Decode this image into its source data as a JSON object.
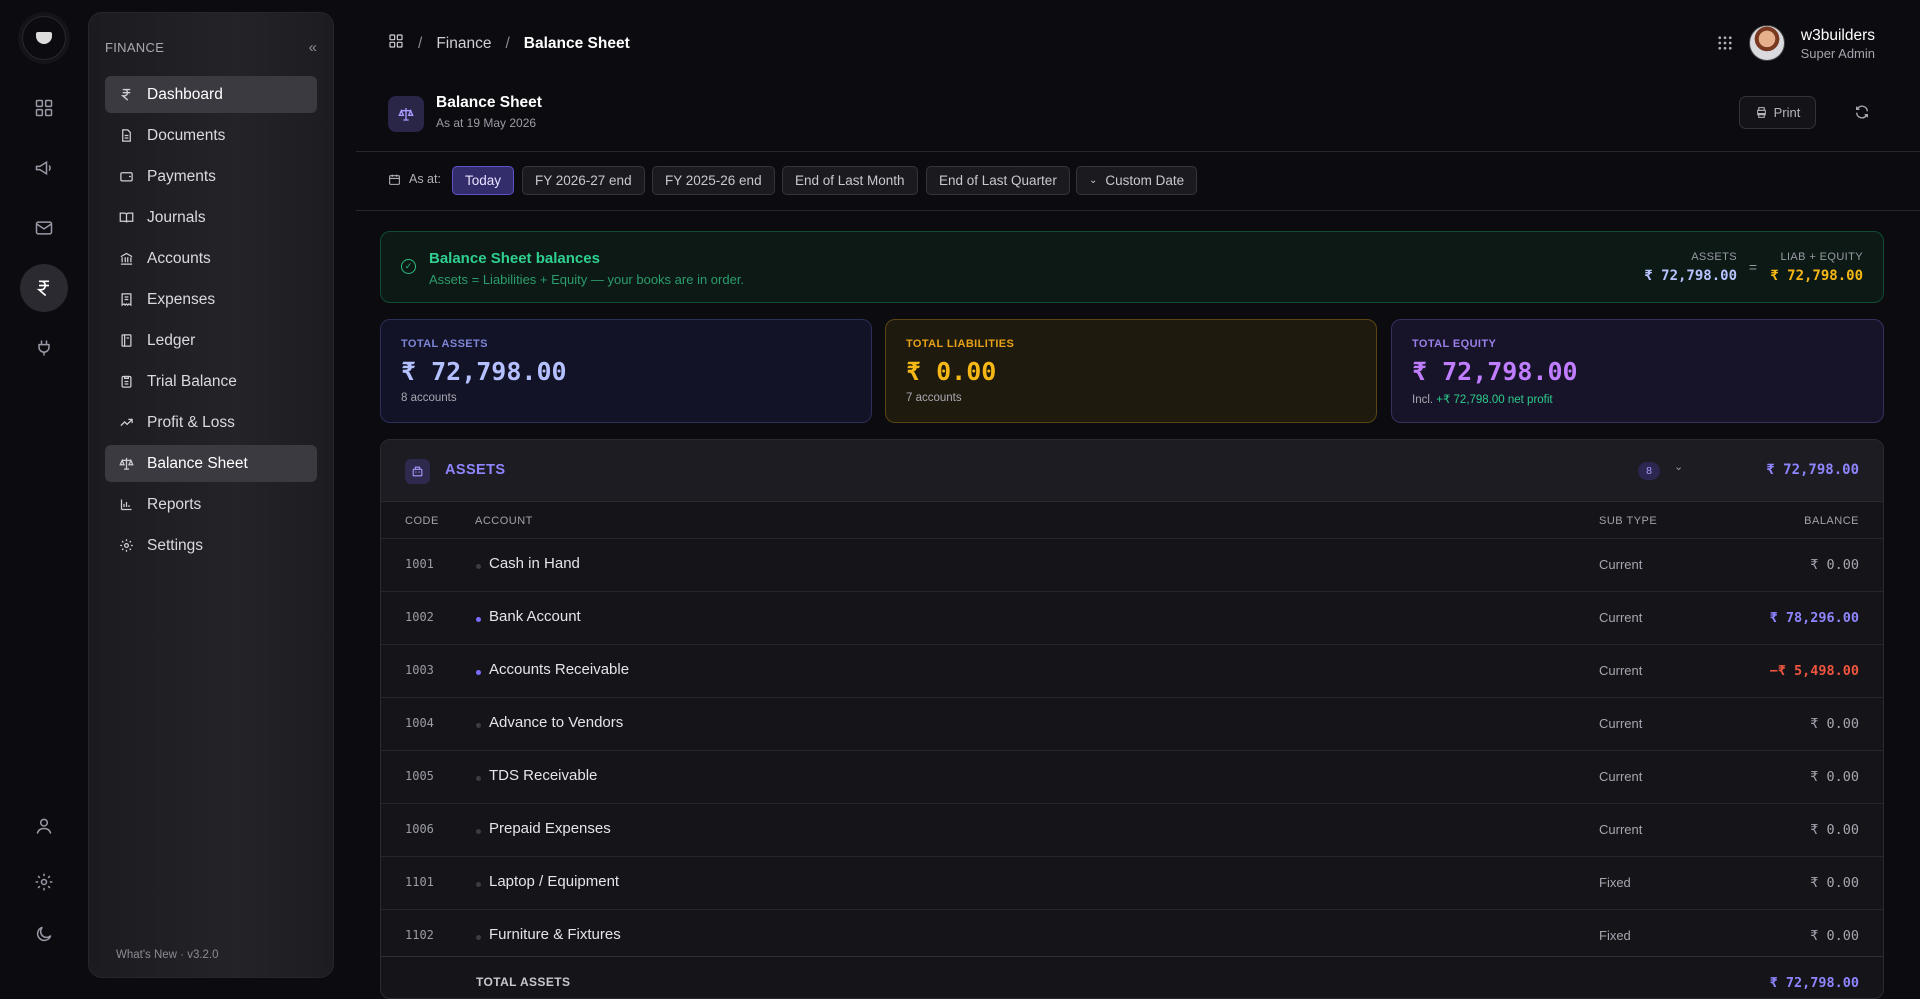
{
  "sidebar": {
    "heading": "FINANCE",
    "collapse_icon": "«",
    "items": [
      {
        "label": "Dashboard",
        "icon": "rupee-icon",
        "active": true
      },
      {
        "label": "Documents",
        "icon": "document-icon"
      },
      {
        "label": "Payments",
        "icon": "wallet-icon"
      },
      {
        "label": "Journals",
        "icon": "book-open-icon"
      },
      {
        "label": "Accounts",
        "icon": "bank-icon"
      },
      {
        "label": "Expenses",
        "icon": "receipt-icon"
      },
      {
        "label": "Ledger",
        "icon": "ledger-icon"
      },
      {
        "label": "Trial Balance",
        "icon": "clipboard-icon"
      },
      {
        "label": "Profit & Loss",
        "icon": "trend-up-icon"
      },
      {
        "label": "Balance Sheet",
        "icon": "scale-icon",
        "active": true
      },
      {
        "label": "Reports",
        "icon": "bar-chart-icon"
      },
      {
        "label": "Settings",
        "icon": "gear-icon"
      }
    ],
    "footer": "What's New · v3.2.0"
  },
  "breadcrumb": {
    "home_icon": "grid-icon",
    "items": [
      "Finance",
      "Balance Sheet"
    ]
  },
  "user": {
    "name": "w3builders",
    "role": "Super Admin"
  },
  "page": {
    "title": "Balance Sheet",
    "subtitle": "As at 19 May 2026",
    "print_label": "Print"
  },
  "filter": {
    "label": "As at:",
    "chips": [
      "Today",
      "FY 2026-27 end",
      "FY 2025-26 end",
      "End of Last Month",
      "End of Last Quarter"
    ],
    "custom_chev": "⌄",
    "custom_label": "Custom Date",
    "active": "Today"
  },
  "banner": {
    "check": "✓",
    "title": "Balance Sheet balances",
    "subtitle": "Assets = Liabilities + Equity — your books are in order.",
    "assets_label": "ASSETS",
    "assets_value": "₹ 72,798.00",
    "equals": "=",
    "liab_label": "LIAB + EQUITY",
    "liab_value": "₹ 72,798.00"
  },
  "cards": {
    "assets": {
      "label": "TOTAL ASSETS",
      "value": "₹ 72,798.00",
      "sub": "8 accounts"
    },
    "liabilities": {
      "label": "TOTAL LIABILITIES",
      "value": "₹ 0.00",
      "sub": "7 accounts"
    },
    "equity": {
      "label": "TOTAL EQUITY",
      "value": "₹ 72,798.00",
      "sub_prefix": "Incl.",
      "sub_highlight": "+₹ 72,798.00 net profit"
    }
  },
  "assets_panel": {
    "title": "ASSETS",
    "count": "8",
    "chev": "⌄",
    "total": "₹ 72,798.00",
    "columns": {
      "code": "CODE",
      "account": "ACCOUNT",
      "sub_type": "SUB TYPE",
      "balance": "BALANCE"
    },
    "rows": [
      {
        "code": "1001",
        "account": "Cash in Hand",
        "sub_type": "Current",
        "balance": "₹ 0.00",
        "state": "zero"
      },
      {
        "code": "1002",
        "account": "Bank Account",
        "sub_type": "Current",
        "balance": "₹ 78,296.00",
        "state": "pos"
      },
      {
        "code": "1003",
        "account": "Accounts Receivable",
        "sub_type": "Current",
        "balance": "−₹ 5,498.00",
        "state": "neg"
      },
      {
        "code": "1004",
        "account": "Advance to Vendors",
        "sub_type": "Current",
        "balance": "₹ 0.00",
        "state": "zero"
      },
      {
        "code": "1005",
        "account": "TDS Receivable",
        "sub_type": "Current",
        "balance": "₹ 0.00",
        "state": "zero"
      },
      {
        "code": "1006",
        "account": "Prepaid Expenses",
        "sub_type": "Current",
        "balance": "₹ 0.00",
        "state": "zero"
      },
      {
        "code": "1101",
        "account": "Laptop / Equipment",
        "sub_type": "Fixed",
        "balance": "₹ 0.00",
        "state": "zero"
      },
      {
        "code": "1102",
        "account": "Furniture & Fixtures",
        "sub_type": "Fixed",
        "balance": "₹ 0.00",
        "state": "zero"
      }
    ],
    "total_label": "TOTAL ASSETS",
    "total_value": "₹ 72,798.00"
  },
  "colors": {
    "accent": "#8f86ff",
    "success": "#2fd08f",
    "warning": "#f5b816",
    "danger": "#f0553f"
  }
}
